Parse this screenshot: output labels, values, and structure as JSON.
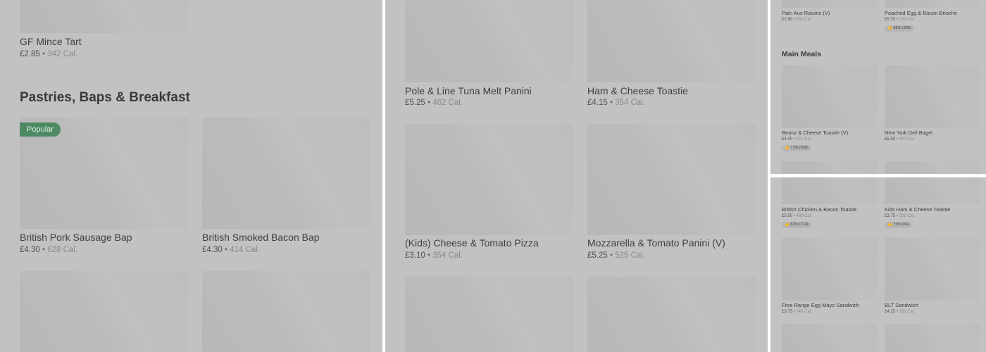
{
  "panel1": {
    "top_item": {
      "name": "GF Mince Tart",
      "price": "£2.85",
      "separator": "•",
      "calories": "342 Cal."
    },
    "section_title": "Pastries, Baps & Breakfast",
    "badge": "Popular",
    "items": [
      {
        "name": "British Pork Sausage Bap",
        "price": "£4.30",
        "separator": "•",
        "calories": "628 Cal."
      },
      {
        "name": "British Smoked Bacon Bap",
        "price": "£4.30",
        "separator": "•",
        "calories": "414 Cal."
      }
    ]
  },
  "panel2": {
    "items": [
      {
        "name": "Pole & Line Tuna Melt Panini",
        "price": "£5.25",
        "separator": "•",
        "calories": "462 Cal."
      },
      {
        "name": "Ham & Cheese Toastie",
        "price": "£4.15",
        "separator": "•",
        "calories": "354 Cal."
      },
      {
        "name": "(Kids) Cheese & Tomato Pizza",
        "price": "£3.10",
        "separator": "•",
        "calories": "354 Cal."
      },
      {
        "name": "Mozzarella & Tomato Panini (V)",
        "price": "£5.25",
        "separator": "•",
        "calories": "525 Cal."
      }
    ]
  },
  "panel3": {
    "top_items": [
      {
        "name": "Pain Aux Raisins (V)",
        "price": "£2.90",
        "separator": "•",
        "calories": "352 Cal."
      },
      {
        "name": "Poached Egg & Bacon Brioche",
        "price": "£5.70",
        "separator": "•",
        "calories": "299 Cal.",
        "rating": "89% (306)"
      }
    ],
    "section_title": "Main Meals",
    "items": [
      {
        "name": "Beanz & Cheese Toastie (V)",
        "price": "£4.00",
        "separator": "•",
        "calories": "321 Cal.",
        "rating": "71% (830)"
      },
      {
        "name": "New York Deli Bagel",
        "price": "£5.50",
        "separator": "•",
        "calories": "337 Cal."
      }
    ]
  },
  "panel4": {
    "items": [
      {
        "name": "British Chicken & Bacon Toastie",
        "price": "£5.50",
        "separator": "•",
        "calories": "480 Cal.",
        "rating": "82% (714)"
      },
      {
        "name": "Kids Ham & Cheese Toastie",
        "price": "£3.75",
        "separator": "•",
        "calories": "281 Cal.",
        "rating": "79% (66)"
      },
      {
        "name": "Free Range Egg Mayo Sandwich",
        "price": "£3.75",
        "separator": "•",
        "calories": "343 Cal."
      },
      {
        "name": "BLT Sandwich",
        "price": "£4.25",
        "separator": "•",
        "calories": "393 Cal."
      }
    ]
  },
  "icons": {
    "rating": "thumbs-up-icon"
  },
  "colors": {
    "overlay": "#c2c2c2",
    "badge": "#4d8a63",
    "divider": "#ffffff"
  }
}
